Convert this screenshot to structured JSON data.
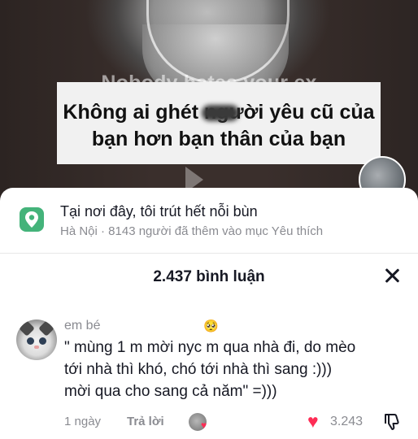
{
  "video": {
    "caption_en": "Nobody hates your ex",
    "caption_vi_line1": "Không ai ghét người yêu cũ của",
    "caption_vi_line2": "bạn hơn bạn thân của bạn"
  },
  "place": {
    "title": "Tại nơi đây, tôi trút hết nỗi bùn",
    "subtitle": "Hà Nội · 8143 người đã thêm vào mục Yêu thích",
    "icon": "map-pin-icon",
    "icon_color": "#44b37a"
  },
  "comments_header": {
    "count_label": "2.437 bình luận"
  },
  "comment": {
    "username": "em bé",
    "emoji": "🥺",
    "lines": [
      "\" mùng 1 m mời nyc m qua nhà đi, do mèo",
      "tới nhà thì khó, chó tới nhà thì sang :)))",
      "mời qua cho sang cả năm\" =)))"
    ],
    "time": "1 ngày",
    "reply_label": "Trả lời",
    "like_count": "3.243",
    "like_color": "#fe2c55"
  }
}
